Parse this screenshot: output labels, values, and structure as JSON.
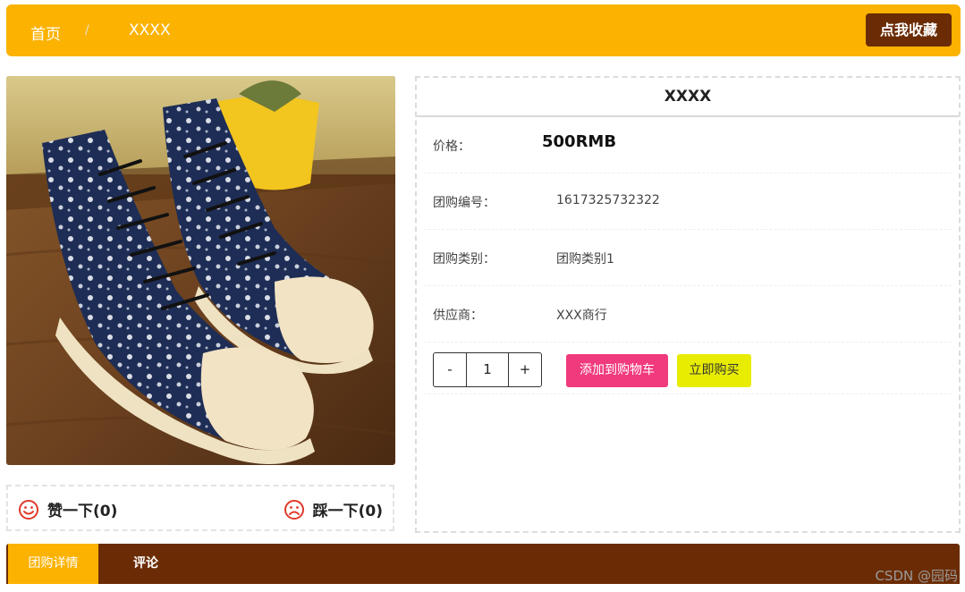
{
  "breadcrumb": {
    "home": "首页",
    "separator": "/",
    "current": "XXXX"
  },
  "favorite_button": "点我收藏",
  "product_image": {
    "alt": "product-photo-sneakers"
  },
  "votes": {
    "like": {
      "label": "赞一下(0)",
      "icon": "smile-face-icon"
    },
    "dislike": {
      "label": "踩一下(0)",
      "icon": "sad-face-icon"
    }
  },
  "product": {
    "title": "XXXX",
    "price_label": "价格：",
    "price_value": "500RMB",
    "id_label": "团购编号：",
    "id_value": "1617325732322",
    "category_label": "团购类别：",
    "category_value": "团购类别1",
    "supplier_label": "供应商：",
    "supplier_value": "XXX商行"
  },
  "quantity": {
    "minus": "-",
    "value": "1",
    "plus": "+"
  },
  "buttons": {
    "add_to_cart": "添加到购物车",
    "buy_now": "立即购买"
  },
  "tabs": [
    {
      "label": "团购详情"
    },
    {
      "label": "评论"
    }
  ],
  "watermark": "CSDN @园码",
  "colors": {
    "accent": "#fbb200",
    "dark": "#6b2c05",
    "cart": "#f03a7d",
    "buy": "#e8ec00"
  }
}
